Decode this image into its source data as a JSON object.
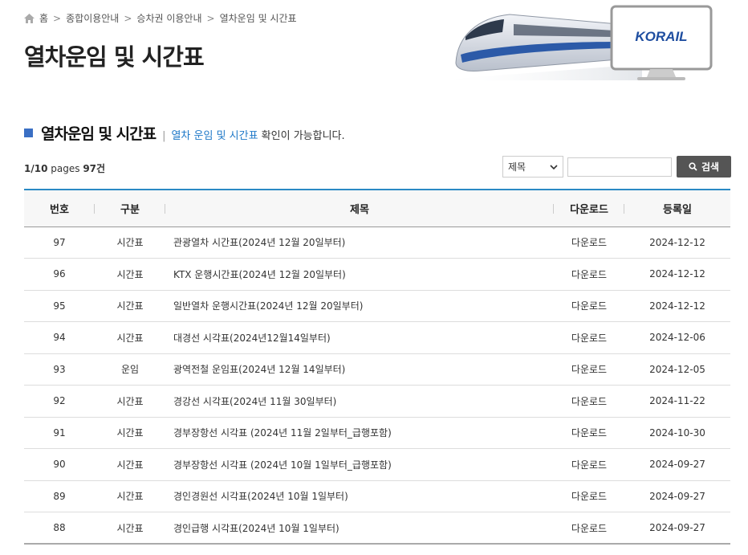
{
  "breadcrumb": {
    "home": "홈",
    "items": [
      "종합이용안내",
      "승차권 이용안내",
      "열차운임 및 시간표"
    ]
  },
  "page_title": "열차운임 및 시간표",
  "banner": {
    "logo_text": "KORAIL"
  },
  "section": {
    "title": "열차운임 및 시간표",
    "desc_highlight": "열차 운임 및 시간표",
    "desc_rest": " 확인이 가능합니다."
  },
  "pager": {
    "current": "1/10",
    "unit": "pages",
    "count": "97건"
  },
  "search": {
    "select_value": "제목",
    "input_value": "",
    "button_label": "검색"
  },
  "table": {
    "headers": [
      "번호",
      "구분",
      "제목",
      "다운로드",
      "등록일"
    ],
    "rows": [
      {
        "no": "97",
        "type": "시간표",
        "title": "관광열차 시간표(2024년 12월 20일부터)",
        "dl": "다운로드",
        "date": "2024-12-12"
      },
      {
        "no": "96",
        "type": "시간표",
        "title": "KTX 운행시간표(2024년 12월 20일부터)",
        "dl": "다운로드",
        "date": "2024-12-12"
      },
      {
        "no": "95",
        "type": "시간표",
        "title": "일반열차 운행시간표(2024년 12월 20일부터)",
        "dl": "다운로드",
        "date": "2024-12-12"
      },
      {
        "no": "94",
        "type": "시간표",
        "title": "대경선 시각표(2024년12월14일부터)",
        "dl": "다운로드",
        "date": "2024-12-06"
      },
      {
        "no": "93",
        "type": "운임",
        "title": "광역전철 운임표(2024년 12월 14일부터)",
        "dl": "다운로드",
        "date": "2024-12-05"
      },
      {
        "no": "92",
        "type": "시간표",
        "title": "경강선 시각표(2024년 11월 30일부터)",
        "dl": "다운로드",
        "date": "2024-11-22"
      },
      {
        "no": "91",
        "type": "시간표",
        "title": "경부장항선 시각표 (2024년 11월 2일부터_급행포함)",
        "dl": "다운로드",
        "date": "2024-10-30"
      },
      {
        "no": "90",
        "type": "시간표",
        "title": "경부장항선 시각표 (2024년 10월 1일부터_급행포함)",
        "dl": "다운로드",
        "date": "2024-09-27"
      },
      {
        "no": "89",
        "type": "시간표",
        "title": "경인경원선 시각표(2024년 10월 1일부터)",
        "dl": "다운로드",
        "date": "2024-09-27"
      },
      {
        "no": "88",
        "type": "시간표",
        "title": "경인급행 시각표(2024년 10월 1일부터)",
        "dl": "다운로드",
        "date": "2024-09-27"
      }
    ]
  }
}
